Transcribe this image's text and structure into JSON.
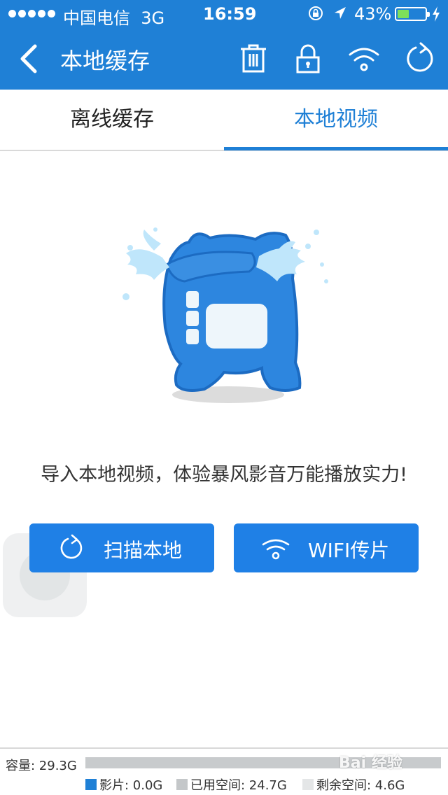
{
  "status_bar": {
    "carrier": "中国电信",
    "network": "3G",
    "time": "16:59",
    "battery_percent_label": "43%",
    "battery_level": 0.43,
    "battery_color": "#7ee05b"
  },
  "nav": {
    "title": "本地缓存",
    "back_icon": "chevron-left-icon",
    "actions": [
      "trash-icon",
      "lock-icon",
      "wifi-icon",
      "refresh-icon"
    ]
  },
  "tabs": {
    "offline": "离线缓存",
    "local_video": "本地视频",
    "active": "local_video"
  },
  "empty_state": {
    "message": "导入本地视频，体验暴风影音万能播放实力!"
  },
  "buttons": {
    "scan_label": "扫描本地",
    "wifi_label": "WIFI传片"
  },
  "storage": {
    "capacity_label": "容量: 29.3G",
    "movies_label": "影片: 0.0G",
    "used_label": "已用空间: 24.7G",
    "free_label": "剩余空间: 4.6G",
    "movies_color": "#1f80d6",
    "used_color": "#c4c7c9",
    "free_color": "#e4e6e7"
  },
  "watermark": "Bai 经验",
  "colors": {
    "primary": "#1f80d6",
    "button": "#1f80e6"
  }
}
